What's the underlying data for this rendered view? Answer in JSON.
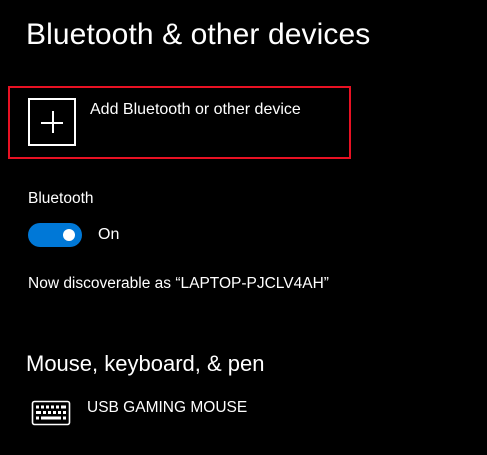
{
  "page": {
    "title": "Bluetooth & other devices"
  },
  "add_device": {
    "label": "Add Bluetooth or other device",
    "icon": "plus-icon",
    "highlight_color": "#e81123"
  },
  "bluetooth": {
    "label": "Bluetooth",
    "toggle_state": "On",
    "toggle_on": true,
    "toggle_color": "#0078d7",
    "discoverable_text": "Now discoverable as “LAPTOP-PJCLV4AH”"
  },
  "mouse_section": {
    "heading": "Mouse, keyboard, & pen",
    "devices": [
      {
        "name": "USB GAMING MOUSE",
        "icon": "keyboard-icon"
      }
    ]
  }
}
